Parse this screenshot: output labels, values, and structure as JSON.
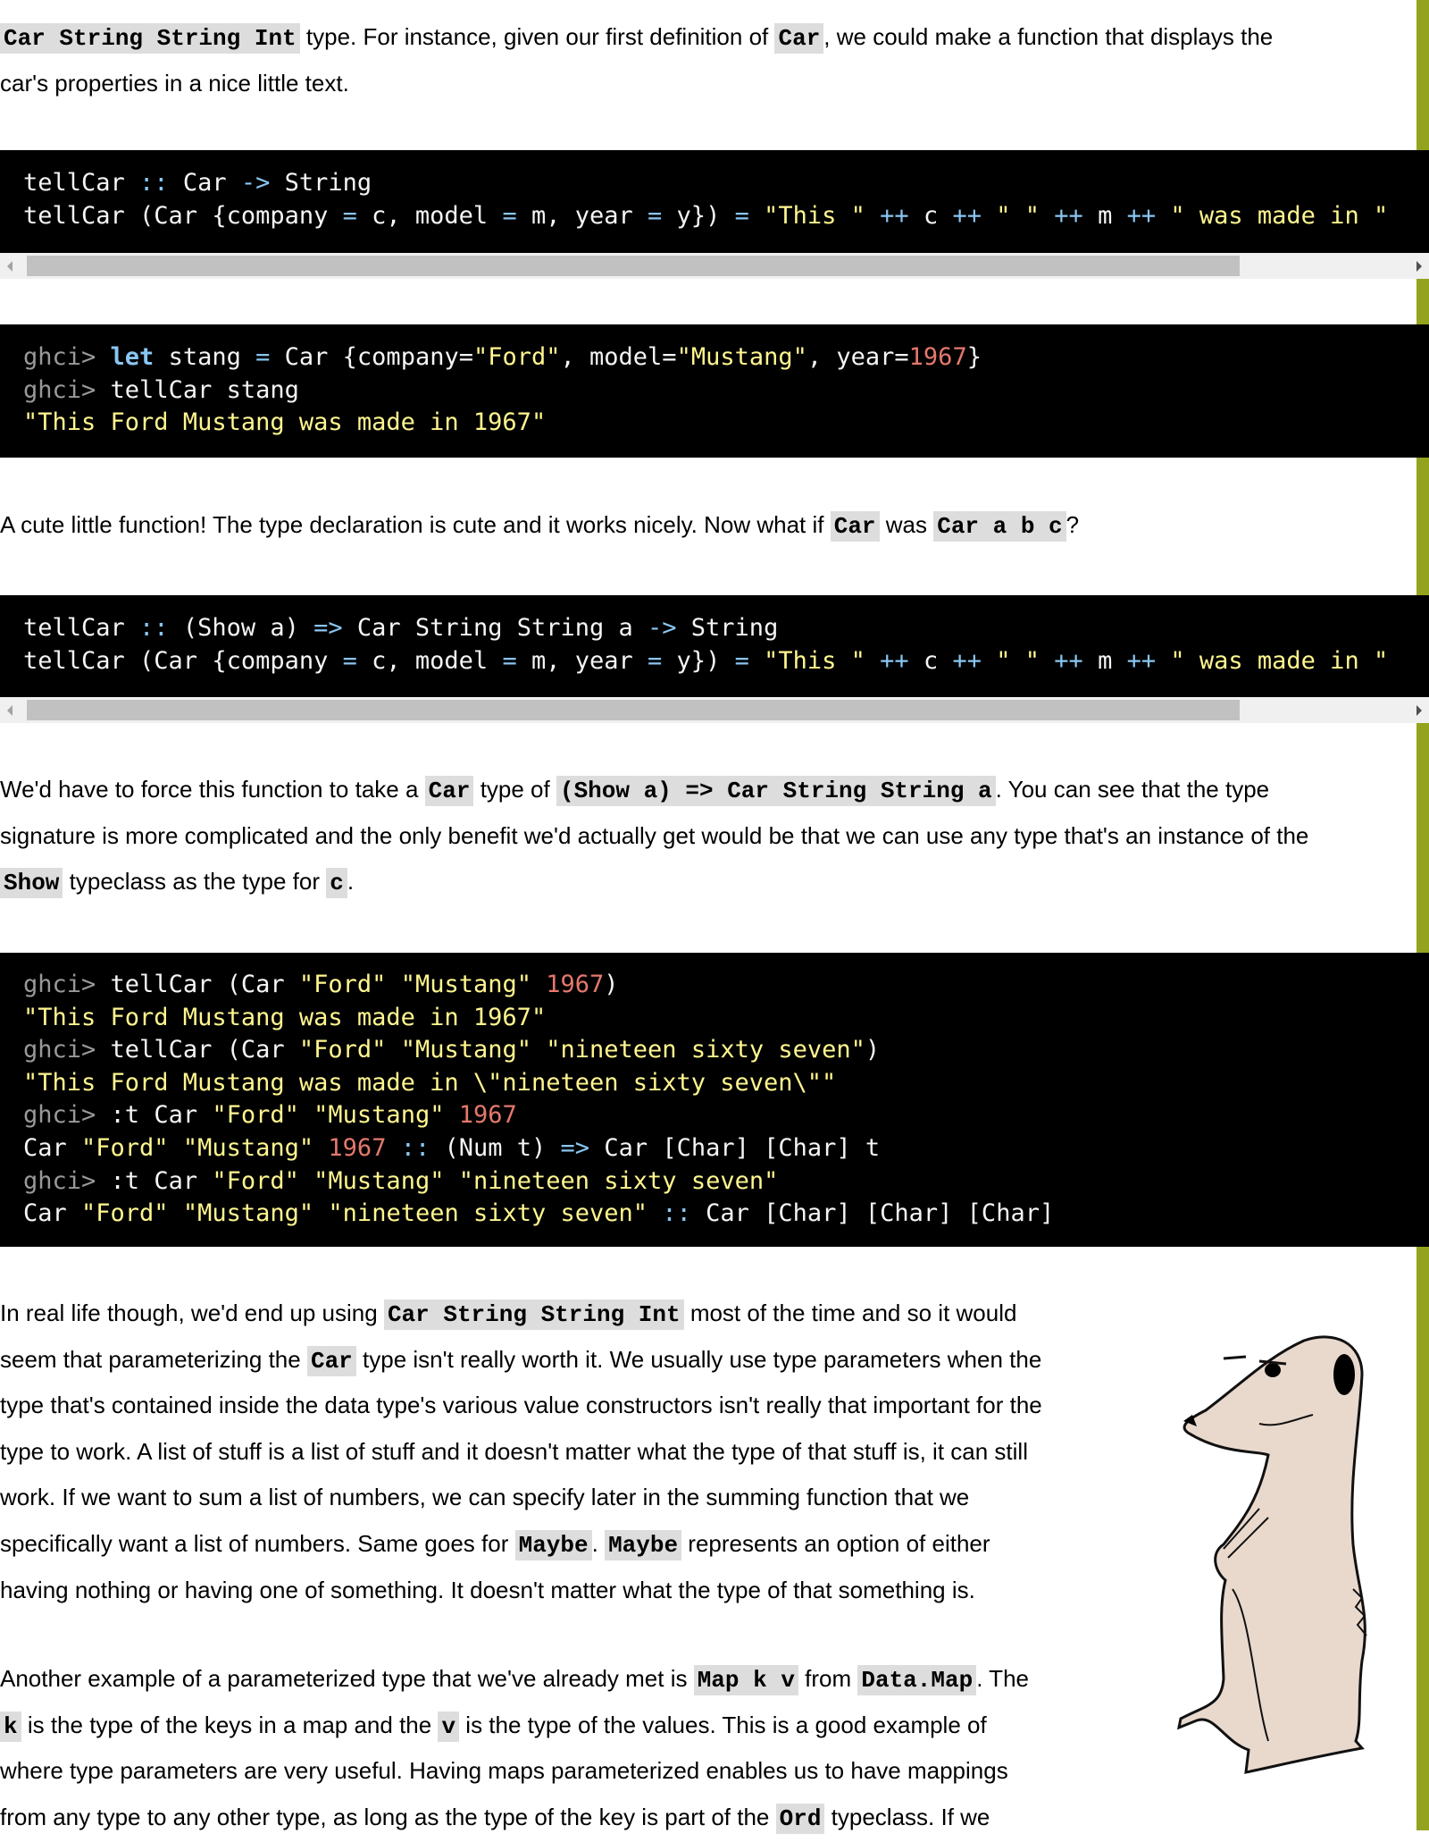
{
  "colors": {
    "accent_bar": "#94a31e",
    "code_bg": "#000000",
    "string": "#fff68f",
    "number": "#e5786d",
    "operator": "#8ac6f2",
    "prompt": "#999999"
  },
  "paragraphs": [
    {
      "id": "p1",
      "lines": [
        [
          [
            "c",
            "Car String String Int"
          ],
          [
            "t",
            " type. For instance, given our first definition of "
          ],
          [
            "c",
            "Car"
          ],
          [
            "t",
            ", we could make a function that displays the"
          ]
        ],
        [
          [
            "t",
            "car's properties in a nice little text."
          ]
        ]
      ]
    },
    {
      "id": "p2",
      "lines": [
        [
          [
            "t",
            "A cute little function! The type declaration is cute and it works nicely. Now what if "
          ],
          [
            "c",
            "Car"
          ],
          [
            "t",
            " was "
          ],
          [
            "c",
            "Car a b c"
          ],
          [
            "t",
            "?"
          ]
        ]
      ]
    },
    {
      "id": "p3",
      "lines": [
        [
          [
            "t",
            "We'd have to force this function to take a "
          ],
          [
            "c",
            "Car"
          ],
          [
            "t",
            " type of "
          ],
          [
            "c",
            "(Show a) => Car String String a"
          ],
          [
            "t",
            ". You can see that the type"
          ]
        ],
        [
          [
            "t",
            "signature is more complicated and the only benefit we'd actually get would be that we can use any type that's an instance of the"
          ]
        ],
        [
          [
            "c",
            "Show"
          ],
          [
            "t",
            " typeclass as the type for "
          ],
          [
            "c",
            "c"
          ],
          [
            "t",
            "."
          ]
        ]
      ]
    },
    {
      "id": "p4",
      "lines": [
        [
          [
            "t",
            "In real life though, we'd end up using "
          ],
          [
            "c",
            "Car String String Int"
          ],
          [
            "t",
            " most of the time and so it would"
          ]
        ],
        [
          [
            "t",
            "seem that parameterizing the "
          ],
          [
            "c",
            "Car"
          ],
          [
            "t",
            " type isn't really worth it. We usually use type parameters when the"
          ]
        ],
        [
          [
            "t",
            "type that's contained inside the data type's various value constructors isn't really that important for the"
          ]
        ],
        [
          [
            "t",
            "type to work. A list of stuff is a list of stuff and it doesn't matter what the type of that stuff is, it can still"
          ]
        ],
        [
          [
            "t",
            "work. If we want to sum a list of numbers, we can specify later in the summing function that we"
          ]
        ],
        [
          [
            "t",
            "specifically want a list of numbers. Same goes for "
          ],
          [
            "c",
            "Maybe"
          ],
          [
            "t",
            ". "
          ],
          [
            "c",
            "Maybe"
          ],
          [
            "t",
            " represents an option of either"
          ]
        ],
        [
          [
            "t",
            "having nothing or having one of something. It doesn't matter what the type of that something is."
          ]
        ]
      ]
    },
    {
      "id": "p5",
      "lines": [
        [
          [
            "t",
            "Another example of a parameterized type that we've already met is "
          ],
          [
            "c",
            "Map k v"
          ],
          [
            "t",
            " from "
          ],
          [
            "c",
            "Data.Map"
          ],
          [
            "t",
            ". The"
          ]
        ],
        [
          [
            "c",
            "k"
          ],
          [
            "t",
            " is the type of the keys in a map and the "
          ],
          [
            "c",
            "v"
          ],
          [
            "t",
            " is the type of the values. This is a good example of"
          ]
        ],
        [
          [
            "t",
            "where type parameters are very useful. Having maps parameterized enables us to have mappings"
          ]
        ],
        [
          [
            "t",
            "from any type to any other type, as long as the type of the key is part of the "
          ],
          [
            "c",
            "Ord"
          ],
          [
            "t",
            " typeclass. If we"
          ]
        ]
      ]
    }
  ],
  "code_blocks": [
    {
      "id": "c1",
      "scrollable": true,
      "lines": [
        [
          [
            "plain",
            "tellCar "
          ],
          [
            "op",
            "::"
          ],
          [
            "plain",
            " Car "
          ],
          [
            "op",
            "->"
          ],
          [
            "plain",
            " String"
          ]
        ],
        [
          [
            "plain",
            "tellCar (Car {company "
          ],
          [
            "op",
            "="
          ],
          [
            "plain",
            " c, model "
          ],
          [
            "op",
            "="
          ],
          [
            "plain",
            " m, year "
          ],
          [
            "op",
            "="
          ],
          [
            "plain",
            " y}) "
          ],
          [
            "op",
            "="
          ],
          [
            "plain",
            " "
          ],
          [
            "str",
            "\"This \""
          ],
          [
            "plain",
            " "
          ],
          [
            "op",
            "++"
          ],
          [
            "plain",
            " c "
          ],
          [
            "op",
            "++"
          ],
          [
            "plain",
            " "
          ],
          [
            "str",
            "\" \""
          ],
          [
            "plain",
            " "
          ],
          [
            "op",
            "++"
          ],
          [
            "plain",
            " m "
          ],
          [
            "op",
            "++"
          ],
          [
            "plain",
            " "
          ],
          [
            "str",
            "\" was made in \""
          ]
        ]
      ]
    },
    {
      "id": "c2",
      "scrollable": false,
      "lines": [
        [
          [
            "prompt",
            "ghci> "
          ],
          [
            "kw",
            "let"
          ],
          [
            "plain",
            " stang "
          ],
          [
            "op",
            "="
          ],
          [
            "plain",
            " Car {company="
          ],
          [
            "str",
            "\"Ford\""
          ],
          [
            "plain",
            ", model="
          ],
          [
            "str",
            "\"Mustang\""
          ],
          [
            "plain",
            ", year="
          ],
          [
            "num",
            "1967"
          ],
          [
            "plain",
            "}"
          ]
        ],
        [
          [
            "prompt",
            "ghci> "
          ],
          [
            "plain",
            "tellCar stang"
          ]
        ],
        [
          [
            "str",
            "\"This Ford Mustang was made in 1967\""
          ]
        ]
      ]
    },
    {
      "id": "c3",
      "scrollable": true,
      "lines": [
        [
          [
            "plain",
            "tellCar "
          ],
          [
            "op",
            "::"
          ],
          [
            "plain",
            " (Show a) "
          ],
          [
            "op",
            "=>"
          ],
          [
            "plain",
            " Car String String a "
          ],
          [
            "op",
            "->"
          ],
          [
            "plain",
            " String"
          ]
        ],
        [
          [
            "plain",
            "tellCar (Car {company "
          ],
          [
            "op",
            "="
          ],
          [
            "plain",
            " c, model "
          ],
          [
            "op",
            "="
          ],
          [
            "plain",
            " m, year "
          ],
          [
            "op",
            "="
          ],
          [
            "plain",
            " y}) "
          ],
          [
            "op",
            "="
          ],
          [
            "plain",
            " "
          ],
          [
            "str",
            "\"This \""
          ],
          [
            "plain",
            " "
          ],
          [
            "op",
            "++"
          ],
          [
            "plain",
            " c "
          ],
          [
            "op",
            "++"
          ],
          [
            "plain",
            " "
          ],
          [
            "str",
            "\" \""
          ],
          [
            "plain",
            " "
          ],
          [
            "op",
            "++"
          ],
          [
            "plain",
            " m "
          ],
          [
            "op",
            "++"
          ],
          [
            "plain",
            " "
          ],
          [
            "str",
            "\" was made in \""
          ]
        ]
      ]
    },
    {
      "id": "c4",
      "scrollable": false,
      "lines": [
        [
          [
            "prompt",
            "ghci> "
          ],
          [
            "plain",
            "tellCar (Car "
          ],
          [
            "str",
            "\"Ford\""
          ],
          [
            "plain",
            " "
          ],
          [
            "str",
            "\"Mustang\""
          ],
          [
            "plain",
            " "
          ],
          [
            "num",
            "1967"
          ],
          [
            "plain",
            ")"
          ]
        ],
        [
          [
            "str",
            "\"This Ford Mustang was made in 1967\""
          ]
        ],
        [
          [
            "prompt",
            "ghci> "
          ],
          [
            "plain",
            "tellCar (Car "
          ],
          [
            "str",
            "\"Ford\""
          ],
          [
            "plain",
            " "
          ],
          [
            "str",
            "\"Mustang\""
          ],
          [
            "plain",
            " "
          ],
          [
            "str",
            "\"nineteen sixty seven\""
          ],
          [
            "plain",
            ")"
          ]
        ],
        [
          [
            "str",
            "\"This Ford Mustang was made in \\\"nineteen sixty seven\\\"\""
          ]
        ],
        [
          [
            "prompt",
            "ghci> "
          ],
          [
            "plain",
            ":t Car "
          ],
          [
            "str",
            "\"Ford\""
          ],
          [
            "plain",
            " "
          ],
          [
            "str",
            "\"Mustang\""
          ],
          [
            "plain",
            " "
          ],
          [
            "num",
            "1967"
          ]
        ],
        [
          [
            "plain",
            "Car "
          ],
          [
            "str",
            "\"Ford\""
          ],
          [
            "plain",
            " "
          ],
          [
            "str",
            "\"Mustang\""
          ],
          [
            "plain",
            " "
          ],
          [
            "num",
            "1967"
          ],
          [
            "plain",
            " "
          ],
          [
            "op",
            "::"
          ],
          [
            "plain",
            " (Num t) "
          ],
          [
            "op",
            "=>"
          ],
          [
            "plain",
            " Car [Char] [Char] t"
          ]
        ],
        [
          [
            "prompt",
            "ghci> "
          ],
          [
            "plain",
            ":t Car "
          ],
          [
            "str",
            "\"Ford\""
          ],
          [
            "plain",
            " "
          ],
          [
            "str",
            "\"Mustang\""
          ],
          [
            "plain",
            " "
          ],
          [
            "str",
            "\"nineteen sixty seven\""
          ]
        ],
        [
          [
            "plain",
            "Car "
          ],
          [
            "str",
            "\"Ford\""
          ],
          [
            "plain",
            " "
          ],
          [
            "str",
            "\"Mustang\""
          ],
          [
            "plain",
            " "
          ],
          [
            "str",
            "\"nineteen sixty seven\""
          ],
          [
            "plain",
            " "
          ],
          [
            "op",
            "::"
          ],
          [
            "plain",
            " Car [Char] [Char] [Char]"
          ]
        ]
      ]
    }
  ]
}
